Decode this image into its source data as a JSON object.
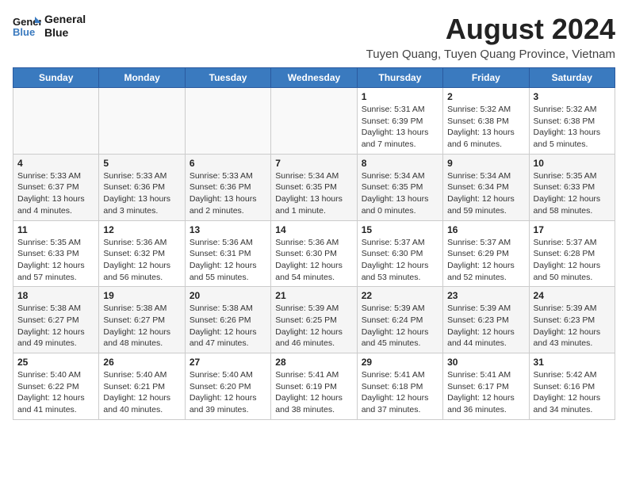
{
  "logo": {
    "line1": "General",
    "line2": "Blue"
  },
  "title": "August 2024",
  "subtitle": "Tuyen Quang, Tuyen Quang Province, Vietnam",
  "weekdays": [
    "Sunday",
    "Monday",
    "Tuesday",
    "Wednesday",
    "Thursday",
    "Friday",
    "Saturday"
  ],
  "weeks": [
    [
      {
        "day": "",
        "info": ""
      },
      {
        "day": "",
        "info": ""
      },
      {
        "day": "",
        "info": ""
      },
      {
        "day": "",
        "info": ""
      },
      {
        "day": "1",
        "info": "Sunrise: 5:31 AM\nSunset: 6:39 PM\nDaylight: 13 hours\nand 7 minutes."
      },
      {
        "day": "2",
        "info": "Sunrise: 5:32 AM\nSunset: 6:38 PM\nDaylight: 13 hours\nand 6 minutes."
      },
      {
        "day": "3",
        "info": "Sunrise: 5:32 AM\nSunset: 6:38 PM\nDaylight: 13 hours\nand 5 minutes."
      }
    ],
    [
      {
        "day": "4",
        "info": "Sunrise: 5:33 AM\nSunset: 6:37 PM\nDaylight: 13 hours\nand 4 minutes."
      },
      {
        "day": "5",
        "info": "Sunrise: 5:33 AM\nSunset: 6:36 PM\nDaylight: 13 hours\nand 3 minutes."
      },
      {
        "day": "6",
        "info": "Sunrise: 5:33 AM\nSunset: 6:36 PM\nDaylight: 13 hours\nand 2 minutes."
      },
      {
        "day": "7",
        "info": "Sunrise: 5:34 AM\nSunset: 6:35 PM\nDaylight: 13 hours\nand 1 minute."
      },
      {
        "day": "8",
        "info": "Sunrise: 5:34 AM\nSunset: 6:35 PM\nDaylight: 13 hours\nand 0 minutes."
      },
      {
        "day": "9",
        "info": "Sunrise: 5:34 AM\nSunset: 6:34 PM\nDaylight: 12 hours\nand 59 minutes."
      },
      {
        "day": "10",
        "info": "Sunrise: 5:35 AM\nSunset: 6:33 PM\nDaylight: 12 hours\nand 58 minutes."
      }
    ],
    [
      {
        "day": "11",
        "info": "Sunrise: 5:35 AM\nSunset: 6:33 PM\nDaylight: 12 hours\nand 57 minutes."
      },
      {
        "day": "12",
        "info": "Sunrise: 5:36 AM\nSunset: 6:32 PM\nDaylight: 12 hours\nand 56 minutes."
      },
      {
        "day": "13",
        "info": "Sunrise: 5:36 AM\nSunset: 6:31 PM\nDaylight: 12 hours\nand 55 minutes."
      },
      {
        "day": "14",
        "info": "Sunrise: 5:36 AM\nSunset: 6:30 PM\nDaylight: 12 hours\nand 54 minutes."
      },
      {
        "day": "15",
        "info": "Sunrise: 5:37 AM\nSunset: 6:30 PM\nDaylight: 12 hours\nand 53 minutes."
      },
      {
        "day": "16",
        "info": "Sunrise: 5:37 AM\nSunset: 6:29 PM\nDaylight: 12 hours\nand 52 minutes."
      },
      {
        "day": "17",
        "info": "Sunrise: 5:37 AM\nSunset: 6:28 PM\nDaylight: 12 hours\nand 50 minutes."
      }
    ],
    [
      {
        "day": "18",
        "info": "Sunrise: 5:38 AM\nSunset: 6:27 PM\nDaylight: 12 hours\nand 49 minutes."
      },
      {
        "day": "19",
        "info": "Sunrise: 5:38 AM\nSunset: 6:27 PM\nDaylight: 12 hours\nand 48 minutes."
      },
      {
        "day": "20",
        "info": "Sunrise: 5:38 AM\nSunset: 6:26 PM\nDaylight: 12 hours\nand 47 minutes."
      },
      {
        "day": "21",
        "info": "Sunrise: 5:39 AM\nSunset: 6:25 PM\nDaylight: 12 hours\nand 46 minutes."
      },
      {
        "day": "22",
        "info": "Sunrise: 5:39 AM\nSunset: 6:24 PM\nDaylight: 12 hours\nand 45 minutes."
      },
      {
        "day": "23",
        "info": "Sunrise: 5:39 AM\nSunset: 6:23 PM\nDaylight: 12 hours\nand 44 minutes."
      },
      {
        "day": "24",
        "info": "Sunrise: 5:39 AM\nSunset: 6:23 PM\nDaylight: 12 hours\nand 43 minutes."
      }
    ],
    [
      {
        "day": "25",
        "info": "Sunrise: 5:40 AM\nSunset: 6:22 PM\nDaylight: 12 hours\nand 41 minutes."
      },
      {
        "day": "26",
        "info": "Sunrise: 5:40 AM\nSunset: 6:21 PM\nDaylight: 12 hours\nand 40 minutes."
      },
      {
        "day": "27",
        "info": "Sunrise: 5:40 AM\nSunset: 6:20 PM\nDaylight: 12 hours\nand 39 minutes."
      },
      {
        "day": "28",
        "info": "Sunrise: 5:41 AM\nSunset: 6:19 PM\nDaylight: 12 hours\nand 38 minutes."
      },
      {
        "day": "29",
        "info": "Sunrise: 5:41 AM\nSunset: 6:18 PM\nDaylight: 12 hours\nand 37 minutes."
      },
      {
        "day": "30",
        "info": "Sunrise: 5:41 AM\nSunset: 6:17 PM\nDaylight: 12 hours\nand 36 minutes."
      },
      {
        "day": "31",
        "info": "Sunrise: 5:42 AM\nSunset: 6:16 PM\nDaylight: 12 hours\nand 34 minutes."
      }
    ]
  ]
}
